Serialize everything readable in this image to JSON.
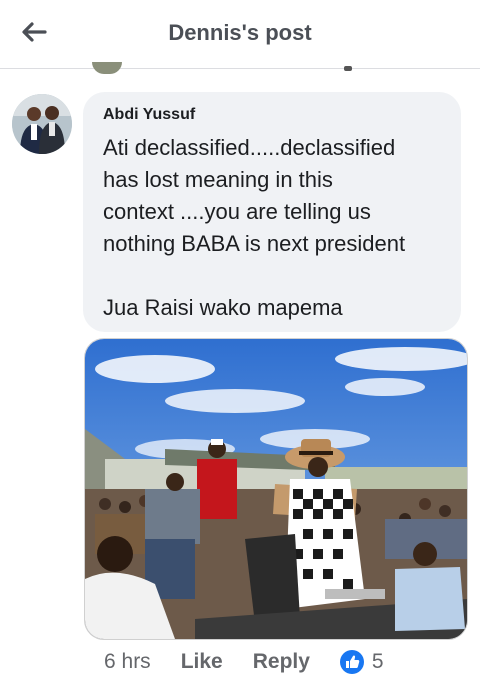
{
  "header": {
    "title": "Dennis's post"
  },
  "comment": {
    "author": "Abdi Yussuf",
    "lines": [
      "Ati declassified.....declassified",
      "has lost meaning in this",
      "context ....you are telling us",
      "nothing BABA is next president",
      "Jua Raisi wako mapema"
    ]
  },
  "actions": {
    "time": "6 hrs",
    "like": "Like",
    "reply": "Reply",
    "reaction_count": "5"
  },
  "colors": {
    "bubble": "#f0f2f5",
    "text": "#1c1e21",
    "muted": "#65676b",
    "like_blue": "#1877f2"
  }
}
